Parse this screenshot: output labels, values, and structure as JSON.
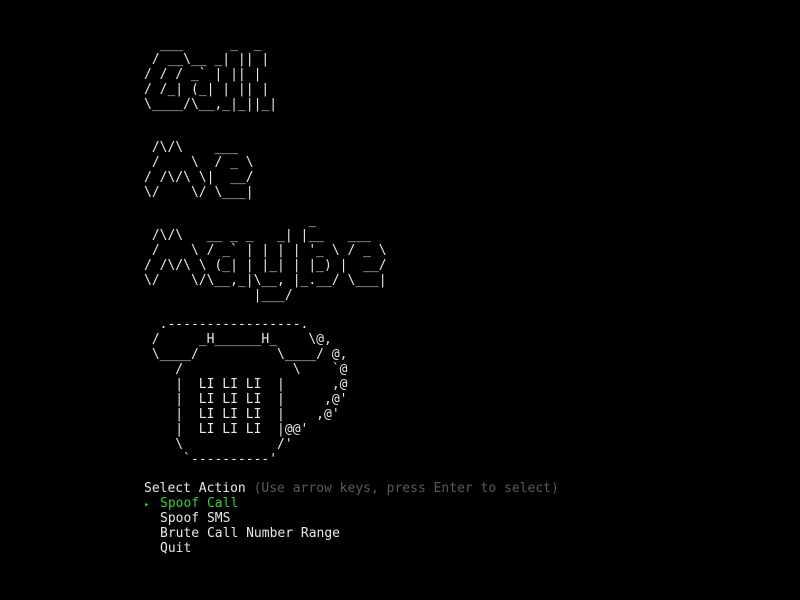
{
  "window": {
    "background": "#000000",
    "text_color": "#e8e8e8"
  },
  "banner": {
    "call": "  ___      _  _\n / __\\__ _| || |\n/ / / _` | || |\n/ /_| (_| | || |\n\\____/\\__,_|_||_|",
    "me": " /\\/\\    ___\n /    \\  / _ \\\n/ /\\/\\ \\|  __/\n\\/    \\/ \\___|",
    "maybe": "                     _\n /\\/\\   __ _ _   _| |__   ___\n /    \\ / _` | | | | '_ \\ / _ \\\n/ /\\/\\ \\ (_| | |_| | |_) |  __/\n\\/    \\/\\__,_|\\__, |_.__/ \\___|\n              |___/",
    "phone": "  .-----------------.\n /     _H______H_    \\@,\n \\____/          \\____/ @,\n    /              \\    `@\n    |  LI LI LI  |      ,@\n    |  LI LI LI  |     ,@'\n    |  LI LI LI  |    ,@'\n    |  LI LI LI  |@@'\n    \\            /'\n     `----------'"
  },
  "prompt": {
    "question": "Select Action",
    "hint": "(Use arrow keys, press Enter to select)"
  },
  "menu": {
    "pointer_icon": "▸",
    "accent_color": "#3ccf3c",
    "items": [
      {
        "label": "Spoof Call",
        "selected": true
      },
      {
        "label": "Spoof SMS",
        "selected": false
      },
      {
        "label": "Brute Call Number Range",
        "selected": false
      },
      {
        "label": "Quit",
        "selected": false
      }
    ]
  }
}
